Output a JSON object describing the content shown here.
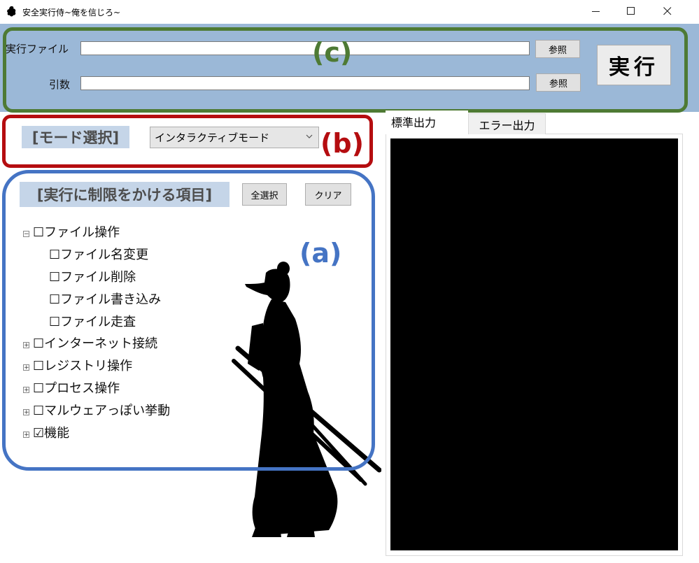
{
  "window": {
    "title": "安全実行侍~俺を信じろ~",
    "controls": {
      "minimize_icon": "minimize-icon",
      "maximize_icon": "maximize-icon",
      "close_icon": "close-icon"
    }
  },
  "annotations": {
    "a": "(a)",
    "b": "(b)",
    "c": "(c)"
  },
  "colors": {
    "annotation_a": "#4574c4",
    "annotation_b": "#b50d10",
    "annotation_c": "#4e7a34",
    "top_panel_bg": "#9bb8d7",
    "section_title_bg": "#c5d5e8",
    "console_bg": "#000000"
  },
  "execution": {
    "file_label": "実行ファイル",
    "file_value": "",
    "args_label": "引数",
    "args_value": "",
    "browse_label": "参照",
    "run_label": "実行"
  },
  "mode": {
    "title": "[モード選択]",
    "selected": "インタラクティブモード"
  },
  "restrictions": {
    "title": "[実行に制限をかける項目]",
    "select_all_label": "全選択",
    "clear_label": "クリア",
    "items": [
      {
        "label": "ファイル操作",
        "checked": false,
        "expanded": true
      },
      {
        "label": "ファイル名変更",
        "checked": false
      },
      {
        "label": "ファイル削除",
        "checked": false
      },
      {
        "label": "ファイル書き込み",
        "checked": false
      },
      {
        "label": "ファイル走査",
        "checked": false
      },
      {
        "label": "インターネット接続",
        "checked": false,
        "expanded": false
      },
      {
        "label": "レジストリ操作",
        "checked": false,
        "expanded": false
      },
      {
        "label": "プロセス操作",
        "checked": false,
        "expanded": false
      },
      {
        "label": "マルウェアっぽい挙動",
        "checked": false,
        "expanded": false
      },
      {
        "label": "機能",
        "checked": true,
        "expanded": false
      }
    ],
    "unchecked_glyph": "☐",
    "checked_glyph": "☑",
    "expanded_glyph": "⊟",
    "collapsed_glyph": "⊞"
  },
  "output": {
    "tabs": [
      {
        "label": "標準出力",
        "active": true
      },
      {
        "label": "エラー出力",
        "active": false
      }
    ],
    "console_text": ""
  }
}
